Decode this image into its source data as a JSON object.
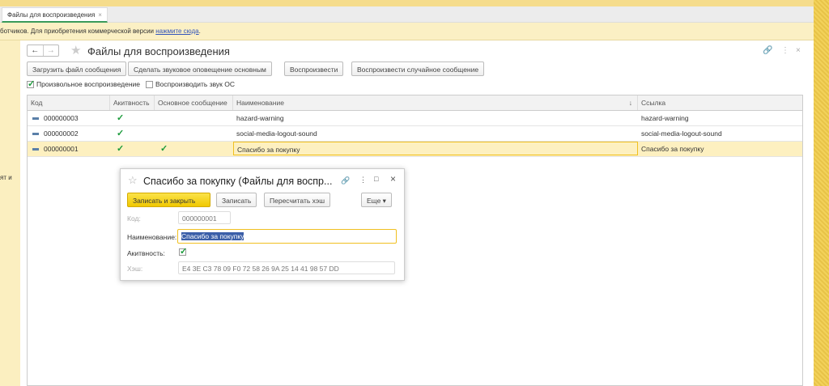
{
  "tab": {
    "label": "Файлы для воспроизведения",
    "close": "×"
  },
  "info": {
    "text": "ботчиков. Для приобретения коммерческой версии ",
    "link": "нажмите сюда",
    "end": "."
  },
  "left_text": "ят и",
  "page": {
    "title": "Файлы для воспроизведения",
    "back": "←",
    "forward": "→",
    "star": "★",
    "link_icon": "🔗",
    "more": "⋮",
    "close": "×"
  },
  "toolbar": [
    "Загрузить файл сообщения",
    "Сделать звуковое оповещение основным",
    "Воспроизвести",
    "Воспроизвести случайное сообщение"
  ],
  "options": {
    "random": "Произвольное воспроизведение",
    "random_checked": true,
    "os_sound": "Воспроизводить звук ОС",
    "os_sound_checked": false
  },
  "table": {
    "headers": [
      "Код",
      "Акитвность",
      "Основное сообщение",
      "Наименование",
      "Ссылка"
    ],
    "sort_icon": "↓",
    "rows": [
      {
        "code": "000000003",
        "active": "✓",
        "main": "",
        "name": "hazard-warning",
        "link": "hazard-warning"
      },
      {
        "code": "000000002",
        "active": "✓",
        "main": "",
        "name": "social-media-logout-sound",
        "link": "social-media-logout-sound"
      },
      {
        "code": "000000001",
        "active": "✓",
        "main": "✓",
        "name": "Спасибо за покупку",
        "link": "Спасибо за покупку"
      }
    ]
  },
  "dialog": {
    "title": "Спасибо за покупку (Файлы для воспр...",
    "star": "☆",
    "link_icon": "🔗",
    "more": "⋮",
    "max": "□",
    "close": "×",
    "save_close": "Записать и закрыть",
    "save": "Записать",
    "rehash": "Пересчитать хэш",
    "more_btn": "Еще ▾",
    "code_label": "Код:",
    "code": "000000001",
    "name_label": "Наименование:",
    "name": "Спасибо за покупку",
    "active_label": "Акитвность:",
    "active": true,
    "hash_label": "Хэш:",
    "hash": "E4 3E C3 78 09 F0 72 58 26 9A 25 14 41 98 57 DD"
  }
}
